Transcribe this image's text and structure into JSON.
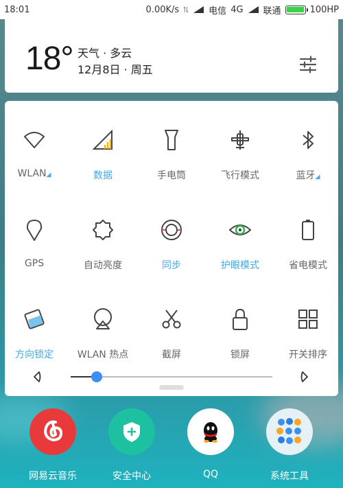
{
  "status_bar": {
    "time": "18:01",
    "net_speed": "0.00K/s",
    "carrier1": "电信",
    "network1": "4G",
    "carrier2": "联通",
    "battery": "100HP",
    "battery_level": 1.0
  },
  "weather": {
    "temperature": "18°",
    "condition": "天气 · 多云",
    "date": "12月8日 · 周五"
  },
  "tiles": [
    {
      "label": "WLAN",
      "icon": "wifi-icon",
      "active": false,
      "has_arrow": true
    },
    {
      "label": "数据",
      "icon": "mobile-data-icon",
      "active": true,
      "has_arrow": false
    },
    {
      "label": "手电筒",
      "icon": "flashlight-icon",
      "active": false,
      "has_arrow": false
    },
    {
      "label": "飞行模式",
      "icon": "airplane-icon",
      "active": false,
      "has_arrow": false
    },
    {
      "label": "蓝牙",
      "icon": "bluetooth-icon",
      "active": false,
      "has_arrow": true
    },
    {
      "label": "GPS",
      "icon": "gps-icon",
      "active": false,
      "has_arrow": false
    },
    {
      "label": "自动亮度",
      "icon": "auto-brightness-icon",
      "active": false,
      "has_arrow": false
    },
    {
      "label": "同步",
      "icon": "sync-icon",
      "active": true,
      "has_arrow": false
    },
    {
      "label": "护眼模式",
      "icon": "eye-icon",
      "active": true,
      "has_arrow": false
    },
    {
      "label": "省电模式",
      "icon": "battery-saver-icon",
      "active": false,
      "has_arrow": false
    },
    {
      "label": "方向锁定",
      "icon": "rotation-lock-icon",
      "active": true,
      "has_arrow": false
    },
    {
      "label": "WLAN 热点",
      "icon": "hotspot-icon",
      "active": false,
      "has_arrow": false
    },
    {
      "label": "截屏",
      "icon": "screenshot-icon",
      "active": false,
      "has_arrow": false
    },
    {
      "label": "锁屏",
      "icon": "lock-icon",
      "active": false,
      "has_arrow": false
    },
    {
      "label": "开关排序",
      "icon": "grid-icon",
      "active": false,
      "has_arrow": false
    }
  ],
  "brightness": {
    "level": 0.13
  },
  "dock": [
    {
      "label": "网易云音乐",
      "icon": "netease-music-icon",
      "color": "#e83a3a"
    },
    {
      "label": "安全中心",
      "icon": "security-center-icon",
      "color": "#1dc0a0"
    },
    {
      "label": "QQ",
      "icon": "qq-icon",
      "color": "#ffffff"
    },
    {
      "label": "系统工具",
      "icon": "system-tools-folder-icon",
      "color": "#e6f1f5"
    }
  ],
  "colors": {
    "accent": "#40a9e6",
    "slider_knob": "#3b8ff2"
  }
}
